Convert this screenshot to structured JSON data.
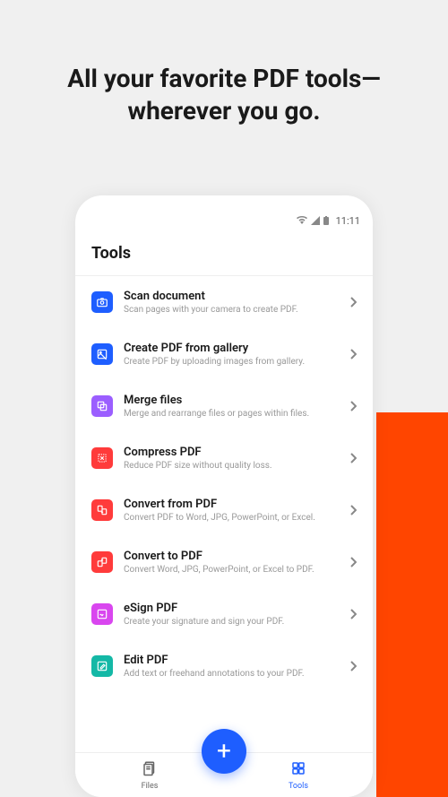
{
  "headline": "All your favorite PDF tools—wherever you go.",
  "status": {
    "time": "11:11"
  },
  "screen": {
    "title": "Tools"
  },
  "tools": [
    {
      "title": "Scan document",
      "desc": "Scan pages with your camera to create PDF."
    },
    {
      "title": "Create PDF from gallery",
      "desc": "Create PDF by uploading images from gallery."
    },
    {
      "title": "Merge files",
      "desc": "Merge and rearrange files or pages within files."
    },
    {
      "title": "Compress PDF",
      "desc": "Reduce PDF size without quality loss."
    },
    {
      "title": "Convert from PDF",
      "desc": "Convert PDF to Word, JPG, PowerPoint, or Excel."
    },
    {
      "title": "Convert to PDF",
      "desc": "Convert Word, JPG, PowerPoint, or Excel to PDF."
    },
    {
      "title": "eSign PDF",
      "desc": "Create your signature and sign your PDF."
    },
    {
      "title": "Edit PDF",
      "desc": "Add text or freehand annotations to your PDF."
    }
  ],
  "nav": {
    "files": "Files",
    "tools": "Tools"
  }
}
